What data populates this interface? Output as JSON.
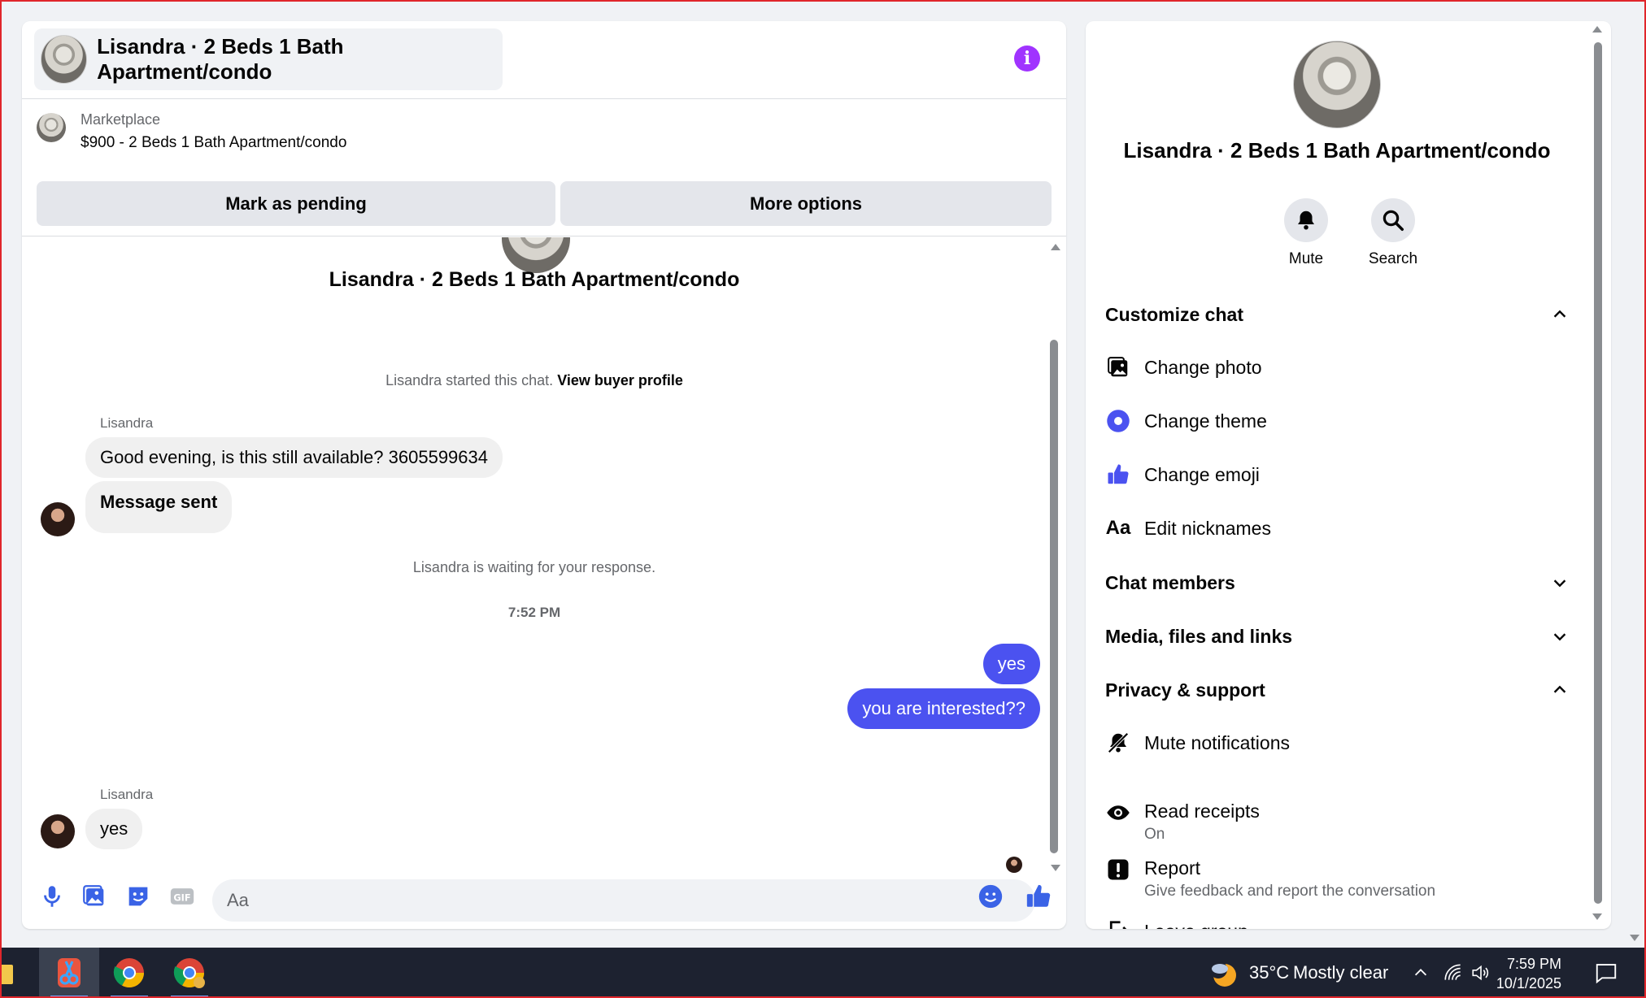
{
  "chat": {
    "header_title": "Lisandra · 2 Beds 1 Bath Apartment/condo",
    "marketplace_label": "Marketplace",
    "marketplace_price": "$900 - 2 Beds 1 Bath Apartment/condo",
    "mark_pending_label": "Mark as pending",
    "more_options_label": "More options",
    "conversation_title": "Lisandra · 2 Beds 1 Bath Apartment/condo",
    "started_text": "Lisandra started this chat.",
    "view_buyer_profile": "View buyer profile",
    "messages": [
      {
        "sender": "Lisandra",
        "text": "Good evening, is this still available?  3605599634"
      },
      {
        "text": "Message sent"
      },
      {
        "system": "Lisandra is waiting for your response."
      },
      {
        "timestamp": "7:52 PM"
      },
      {
        "text": "yes"
      },
      {
        "text": "you are interested??"
      },
      {
        "sender": "Lisandra",
        "text": "yes"
      }
    ],
    "composer_placeholder": "Aa"
  },
  "side": {
    "title": "Lisandra · 2 Beds 1 Bath Apartment/condo",
    "mute_label": "Mute",
    "search_label": "Search",
    "customize_chat": "Customize chat",
    "change_photo": "Change photo",
    "change_theme": "Change theme",
    "change_emoji": "Change emoji",
    "edit_nicknames": "Edit nicknames",
    "nicknames_icon_text": "Aa",
    "chat_members": "Chat members",
    "media_files_links": "Media, files and links",
    "privacy_support": "Privacy & support",
    "mute_notifications": "Mute notifications",
    "read_receipts": "Read receipts",
    "read_receipts_status": "On",
    "report": "Report",
    "report_sub": "Give feedback and report the conversation",
    "leave_group": "Leave group"
  },
  "taskbar": {
    "weather_temp": "35°C",
    "weather_desc": "Mostly clear",
    "time": "7:59 PM",
    "date": "10/1/2025"
  },
  "colors": {
    "accent": "#4b52f0",
    "info": "#a033ff",
    "bubble_in": "#f0f0f0",
    "taskbar": "#1d2230"
  }
}
